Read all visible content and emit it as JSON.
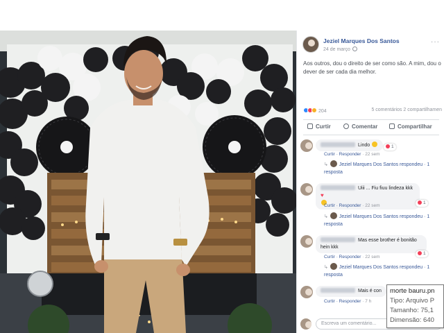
{
  "post": {
    "author": "Jeziel Marques Dos Santos",
    "date": "24 de março",
    "more_icon": "ellipsis-icon",
    "caption": "Aos outros, dou o direito de ser como são. A mim, dou o dever de ser cada dia melhor.",
    "reaction_count": "204",
    "comments_count": "5 comentários",
    "shares_count": "2 compartilhamen"
  },
  "actions": {
    "like": "Curtir",
    "comment": "Comentar",
    "share": "Compartilhar"
  },
  "comments": [
    {
      "text": "Lindo",
      "reaction_badge": "1",
      "meta_reply": "Curtir · Responder",
      "meta_time": " · 22 sem",
      "reply_text": "Jeziel Marques Dos Santos respondeu · 1 resposta"
    },
    {
      "text": "Uiii ... Fiu fiuu lindeza kkk",
      "reaction_badge": "1",
      "meta_reply": "Curtir · Responder",
      "meta_time": " · 22 sem",
      "reply_text": "Jeziel Marques Dos Santos respondeu · 1 resposta"
    },
    {
      "text": "Mas esse brother é bonitão hein kkk",
      "reaction_badge": "1",
      "meta_reply": "Curtir · Responder",
      "meta_time": " · 22 sem",
      "reply_text": "Jeziel Marques Dos Santos respondeu · 1 resposta"
    },
    {
      "text": "Mais é con",
      "meta_reply": "Curtir · Responder",
      "meta_time": " · 7 h"
    }
  ],
  "write_placeholder": "Escreva um comentário...",
  "tooltip": {
    "line1": "morte bauru.pn",
    "line2": "Tipo: Arquivo P",
    "line3": "Tamanho: 75,1",
    "line4": "Dimensão: 640"
  },
  "colors": {
    "link": "#385898",
    "meta": "#90949c",
    "bubble": "#f2f3f5",
    "shirt": "#f1f1ef",
    "pants": "#c9a77c",
    "balloon_black": "#1f1f22",
    "balloon_white": "#f4f4f4"
  }
}
